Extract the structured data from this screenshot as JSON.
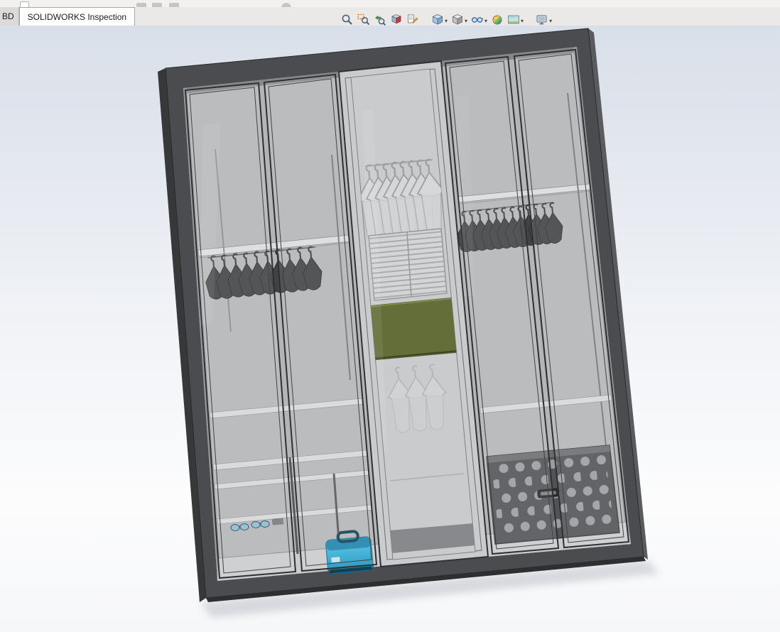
{
  "command_tabs": {
    "items": [
      {
        "label": "BD",
        "active": false
      },
      {
        "label": "SOLIDWORKS Inspection",
        "active": true
      }
    ]
  },
  "heads_up_toolbar": {
    "items": [
      {
        "name": "zoom-to-fit",
        "has_dropdown": false
      },
      {
        "name": "zoom-to-area",
        "has_dropdown": false
      },
      {
        "name": "previous-view",
        "has_dropdown": false
      },
      {
        "name": "section-view",
        "has_dropdown": false
      },
      {
        "name": "dynamic-annotation-views",
        "has_dropdown": false
      },
      {
        "name": "view-orientation",
        "has_dropdown": true
      },
      {
        "name": "display-style",
        "has_dropdown": true
      },
      {
        "name": "hide-show-items",
        "has_dropdown": true
      },
      {
        "name": "edit-appearance",
        "has_dropdown": false
      },
      {
        "name": "apply-scene",
        "has_dropdown": true
      },
      {
        "name": "view-settings",
        "has_dropdown": true
      }
    ]
  },
  "viewport": {
    "background_top": "#d9dfe8",
    "background_bottom": "#f6f7f9",
    "model": {
      "name": "wardrobe-cabinet",
      "colors": {
        "frame": "#4a4c4f",
        "interior": "#b3b5b7",
        "shelf": "#dadcdd",
        "hanger_dark": "#404244",
        "hanger_light": "#d3d5d6",
        "drawer_olive": "#59632a",
        "box_blue": "#2fa7d0",
        "basket_dark": "#515356",
        "glass_tint": "rgba(255,255,255,0.10)"
      }
    }
  }
}
